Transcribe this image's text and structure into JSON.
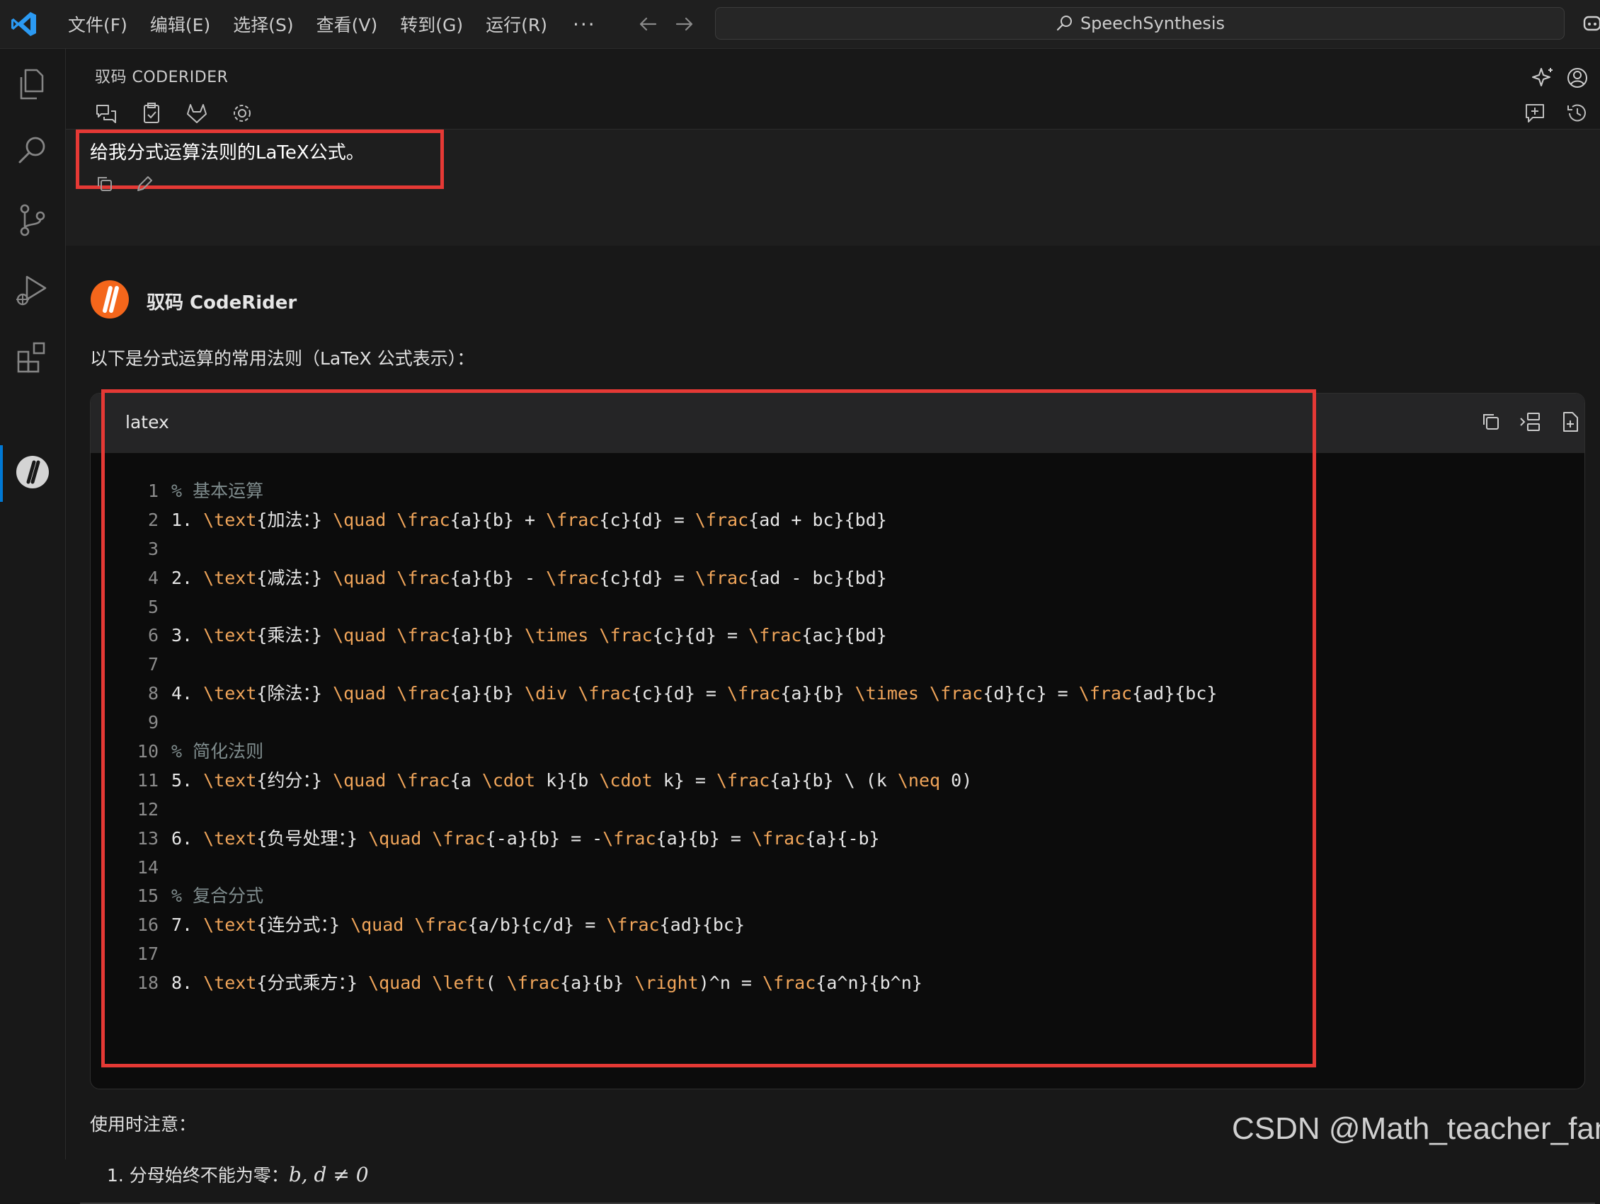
{
  "titlebar": {
    "menu": [
      "文件(F)",
      "编辑(E)",
      "选择(S)",
      "查看(V)",
      "转到(G)",
      "运行(R)"
    ],
    "more": "···",
    "command_center_text": "SpeechSynthesis"
  },
  "activitybar": {
    "items": [
      "explorer-icon",
      "search-icon",
      "source-control-icon",
      "run-debug-icon",
      "extensions-icon",
      "coderider-icon"
    ],
    "active": "coderider-icon"
  },
  "panel": {
    "title": "驭码 CODERIDER",
    "tools": [
      "chat-icon",
      "clipboard-check-icon",
      "gitlab-icon",
      "gear-icon"
    ],
    "right_tools": [
      "sparkle-icon",
      "account-icon",
      "new-chat-icon",
      "history-icon"
    ]
  },
  "user_message": {
    "text": "给我分式运算法则的LaTeX公式。",
    "highlight_color": "#e53935"
  },
  "assistant": {
    "name": "驭码 CodeRider",
    "intro": "以下是分式运算的常用法则（LaTeX 公式表示）：",
    "code_block": {
      "language": "latex",
      "actions": [
        "copy-icon",
        "insert-icon",
        "new-file-icon"
      ],
      "lines": [
        {
          "n": "1",
          "text": "% 基本运算"
        },
        {
          "n": "2",
          "text": "1. \\text{加法：} \\quad \\frac{a}{b} + \\frac{c}{d} = \\frac{ad + bc}{bd}"
        },
        {
          "n": "3",
          "text": ""
        },
        {
          "n": "4",
          "text": "2. \\text{减法：} \\quad \\frac{a}{b} - \\frac{c}{d} = \\frac{ad - bc}{bd}"
        },
        {
          "n": "5",
          "text": ""
        },
        {
          "n": "6",
          "text": "3. \\text{乘法：} \\quad \\frac{a}{b} \\times \\frac{c}{d} = \\frac{ac}{bd}"
        },
        {
          "n": "7",
          "text": ""
        },
        {
          "n": "8",
          "text": "4. \\text{除法：} \\quad \\frac{a}{b} \\div \\frac{c}{d} = \\frac{a}{b} \\times \\frac{d}{c} = \\frac{ad}{bc}"
        },
        {
          "n": "9",
          "text": ""
        },
        {
          "n": "10",
          "text": "% 简化法则"
        },
        {
          "n": "11",
          "text": "5. \\text{约分：} \\quad \\frac{a \\cdot k}{b \\cdot k} = \\frac{a}{b} \\ (k \\neq 0)"
        },
        {
          "n": "12",
          "text": ""
        },
        {
          "n": "13",
          "text": "6. \\text{负号处理：} \\quad \\frac{-a}{b} = -\\frac{a}{b} = \\frac{a}{-b}"
        },
        {
          "n": "14",
          "text": ""
        },
        {
          "n": "15",
          "text": "% 复合分式"
        },
        {
          "n": "16",
          "text": "7. \\text{连分式：} \\quad \\frac{a/b}{c/d} = \\frac{ad}{bc}"
        },
        {
          "n": "17",
          "text": ""
        },
        {
          "n": "18",
          "text": "8. \\text{分式乘方：} \\quad \\left( \\frac{a}{b} \\right)^n = \\frac{a^n}{b^n}"
        }
      ],
      "highlight_color": "#e53935"
    },
    "notes_title": "使用时注意：",
    "notes": [
      {
        "prefix": "1. 分母始终不能为零：",
        "math": "b, d ≠ 0"
      }
    ]
  },
  "watermark": "CSDN @Math_teacher_fan",
  "colors": {
    "accent": "#0078d4",
    "keyword": "#f0a55a",
    "comment": "#7f8c8d",
    "highlight": "#e53935"
  }
}
